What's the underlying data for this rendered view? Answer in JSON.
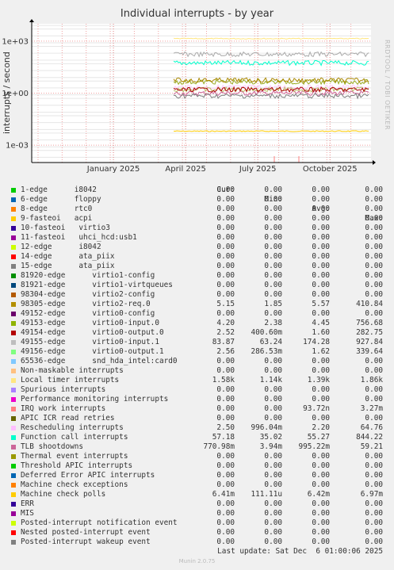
{
  "title": "Individual interrupts - by year",
  "side_label": "RRDTOOL / TOBI OETIKER",
  "chart_data": {
    "type": "line",
    "title": "Individual interrupts - by year",
    "ylabel": "interrupts / second",
    "yscale": "log",
    "ylim": [
      0.0001,
      10000
    ],
    "y_ticks": [
      {
        "value": 1000,
        "label": "1e+03"
      },
      {
        "value": 1,
        "label": "1e+00"
      },
      {
        "value": 0.001,
        "label": "1e-03"
      }
    ],
    "x_ticks": [
      "January 2025",
      "April 2025",
      "July 2025",
      "October 2025"
    ],
    "grid": true,
    "data_start_label": "April 2025",
    "series_levels": [
      {
        "name": "Machine check polls",
        "color": "#ffcc00",
        "level": 0.00642
      },
      {
        "name": "Local timer interrupts",
        "color": "#ffe680",
        "level": 1390
      },
      {
        "name": "TLB shootdowns",
        "color": "#cc6699",
        "level": 0.995
      },
      {
        "name": "Function call interrupts",
        "color": "#00ffcc",
        "level": 55.27
      },
      {
        "name": "Rescheduling interrupts",
        "color": "#ffccff",
        "level": 2.2
      },
      {
        "name": "49155-edge virtio0-input.1",
        "color": "#aaaaaa",
        "level": 174.28
      },
      {
        "name": "49153-edge virtio0-input.0",
        "color": "#99aa22",
        "level": 4.45
      },
      {
        "name": "98305-edge virtio2-req.0",
        "color": "#aa8800",
        "level": 5.57
      },
      {
        "name": "49156-edge virtio0-output.1",
        "color": "#bbbb66",
        "level": 1.62
      },
      {
        "name": "49154-edge virtio0-output.0",
        "color": "#aa0000",
        "level": 1.6
      },
      {
        "name": "Posted-interrupt wakeup event",
        "color": "#7f7f7f",
        "level": 0.7
      }
    ]
  },
  "legend_header": {
    "cur": "Cur:",
    "min": "Min:",
    "avg": "Avg:",
    "max": "Max:"
  },
  "legend": [
    {
      "color": "#00cc00",
      "name": "1-edge      i8042",
      "cur": "0.00",
      "min": "0.00",
      "avg": "0.00",
      "max": "0.00"
    },
    {
      "color": "#0066b3",
      "name": "6-edge      floppy",
      "cur": "0.00",
      "min": "0.00",
      "avg": "0.00",
      "max": "0.00"
    },
    {
      "color": "#ff8000",
      "name": "8-edge      rtc0",
      "cur": "0.00",
      "min": "0.00",
      "avg": "0.00",
      "max": "0.00"
    },
    {
      "color": "#ffcc00",
      "name": "9-fasteoi   acpi",
      "cur": "0.00",
      "min": "0.00",
      "avg": "0.00",
      "max": "0.00"
    },
    {
      "color": "#330099",
      "name": "10-fasteoi   virtio3",
      "cur": "0.00",
      "min": "0.00",
      "avg": "0.00",
      "max": "0.00"
    },
    {
      "color": "#990099",
      "name": "11-fasteoi   uhci_hcd:usb1",
      "cur": "0.00",
      "min": "0.00",
      "avg": "0.00",
      "max": "0.00"
    },
    {
      "color": "#ccff00",
      "name": "12-edge      i8042",
      "cur": "0.00",
      "min": "0.00",
      "avg": "0.00",
      "max": "0.00"
    },
    {
      "color": "#ff0000",
      "name": "14-edge      ata_piix",
      "cur": "0.00",
      "min": "0.00",
      "avg": "0.00",
      "max": "0.00"
    },
    {
      "color": "#808080",
      "name": "15-edge      ata_piix",
      "cur": "0.00",
      "min": "0.00",
      "avg": "0.00",
      "max": "0.00"
    },
    {
      "color": "#008f00",
      "name": "81920-edge      virtio1-config",
      "cur": "0.00",
      "min": "0.00",
      "avg": "0.00",
      "max": "0.00"
    },
    {
      "color": "#00487d",
      "name": "81921-edge      virtio1-virtqueues",
      "cur": "0.00",
      "min": "0.00",
      "avg": "0.00",
      "max": "0.00"
    },
    {
      "color": "#b35a00",
      "name": "98304-edge      virtio2-config",
      "cur": "0.00",
      "min": "0.00",
      "avg": "0.00",
      "max": "0.00"
    },
    {
      "color": "#b38f00",
      "name": "98305-edge      virtio2-req.0",
      "cur": "5.15",
      "min": "1.85",
      "avg": "5.57",
      "max": "410.84"
    },
    {
      "color": "#6b006b",
      "name": "49152-edge      virtio0-config",
      "cur": "0.00",
      "min": "0.00",
      "avg": "0.00",
      "max": "0.00"
    },
    {
      "color": "#8fb300",
      "name": "49153-edge      virtio0-input.0",
      "cur": "4.20",
      "min": "2.38",
      "avg": "4.45",
      "max": "756.68"
    },
    {
      "color": "#b30000",
      "name": "49154-edge      virtio0-output.0",
      "cur": "2.52",
      "min": "400.60m",
      "avg": "1.60",
      "max": "282.75"
    },
    {
      "color": "#bebebe",
      "name": "49155-edge      virtio0-input.1",
      "cur": "83.87",
      "min": "63.24",
      "avg": "174.28",
      "max": "927.84"
    },
    {
      "color": "#80ff80",
      "name": "49156-edge      virtio0-output.1",
      "cur": "2.56",
      "min": "286.53m",
      "avg": "1.62",
      "max": "339.64"
    },
    {
      "color": "#80c9ff",
      "name": "65536-edge      snd_hda_intel:card0",
      "cur": "0.00",
      "min": "0.00",
      "avg": "0.00",
      "max": "0.00"
    },
    {
      "color": "#ffc080",
      "name": "Non-maskable interrupts",
      "cur": "0.00",
      "min": "0.00",
      "avg": "0.00",
      "max": "0.00"
    },
    {
      "color": "#ffe680",
      "name": "Local timer interrupts",
      "cur": "1.58k",
      "min": "1.14k",
      "avg": "1.39k",
      "max": "1.86k"
    },
    {
      "color": "#aa80ff",
      "name": "Spurious interrupts",
      "cur": "0.00",
      "min": "0.00",
      "avg": "0.00",
      "max": "0.00"
    },
    {
      "color": "#ee00cc",
      "name": "Performance monitoring interrupts",
      "cur": "0.00",
      "min": "0.00",
      "avg": "0.00",
      "max": "0.00"
    },
    {
      "color": "#ff8080",
      "name": "IRQ work interrupts",
      "cur": "0.00",
      "min": "0.00",
      "avg": "93.72n",
      "max": "3.27m"
    },
    {
      "color": "#666600",
      "name": "APIC ICR read retries",
      "cur": "0.00",
      "min": "0.00",
      "avg": "0.00",
      "max": "0.00"
    },
    {
      "color": "#ffbfff",
      "name": "Rescheduling interrupts",
      "cur": "2.50",
      "min": "996.04m",
      "avg": "2.20",
      "max": "64.76"
    },
    {
      "color": "#00ffcc",
      "name": "Function call interrupts",
      "cur": "57.18",
      "min": "35.02",
      "avg": "55.27",
      "max": "844.22"
    },
    {
      "color": "#cc6699",
      "name": "TLB shootdowns",
      "cur": "770.98m",
      "min": "3.94m",
      "avg": "995.22m",
      "max": "59.21"
    },
    {
      "color": "#999900",
      "name": "Thermal event interrupts",
      "cur": "0.00",
      "min": "0.00",
      "avg": "0.00",
      "max": "0.00"
    },
    {
      "color": "#00cc00",
      "name": "Threshold APIC interrupts",
      "cur": "0.00",
      "min": "0.00",
      "avg": "0.00",
      "max": "0.00"
    },
    {
      "color": "#0066b3",
      "name": "Deferred Error APIC interrupts",
      "cur": "0.00",
      "min": "0.00",
      "avg": "0.00",
      "max": "0.00"
    },
    {
      "color": "#ff8000",
      "name": "Machine check exceptions",
      "cur": "0.00",
      "min": "0.00",
      "avg": "0.00",
      "max": "0.00"
    },
    {
      "color": "#ffcc00",
      "name": "Machine check polls",
      "cur": "6.41m",
      "min": "111.11u",
      "avg": "6.42m",
      "max": "6.97m"
    },
    {
      "color": "#330099",
      "name": "ERR",
      "cur": "0.00",
      "min": "0.00",
      "avg": "0.00",
      "max": "0.00"
    },
    {
      "color": "#990099",
      "name": "MIS",
      "cur": "0.00",
      "min": "0.00",
      "avg": "0.00",
      "max": "0.00"
    },
    {
      "color": "#ccff00",
      "name": "Posted-interrupt notification event",
      "cur": "0.00",
      "min": "0.00",
      "avg": "0.00",
      "max": "0.00"
    },
    {
      "color": "#ff0000",
      "name": "Nested posted-interrupt event",
      "cur": "0.00",
      "min": "0.00",
      "avg": "0.00",
      "max": "0.00"
    },
    {
      "color": "#808080",
      "name": "Posted-interrupt wakeup event",
      "cur": "0.00",
      "min": "0.00",
      "avg": "0.00",
      "max": "0.00"
    }
  ],
  "last_update": "Last update: Sat Dec  6 01:00:06 2025",
  "munin_version": "Munin 2.0.75"
}
